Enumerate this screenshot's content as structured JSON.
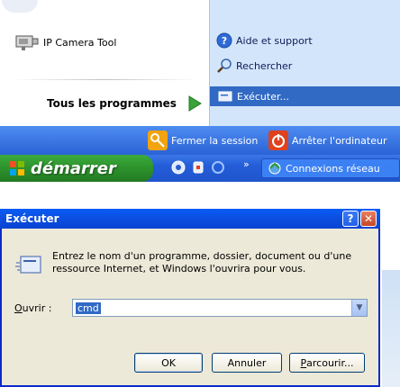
{
  "start_menu": {
    "programs": [
      {
        "label": "IP Camera Tool",
        "icon": "camera-icon"
      }
    ],
    "all_programs_label": "Tous les programmes",
    "right_items": [
      {
        "label": "Aide et support",
        "icon": "help-icon"
      },
      {
        "label": "Rechercher",
        "icon": "search-icon"
      },
      {
        "label": "Exécuter...",
        "icon": "run-icon"
      }
    ],
    "logoff_label": "Fermer la session",
    "shutdown_label": "Arrêter l'ordinateur"
  },
  "taskbar": {
    "start_label": "démarrer",
    "more_label": "»",
    "task_button_label": "Connexions réseau"
  },
  "dialog": {
    "title": "Exécuter",
    "description": "Entrez le nom d'un programme, dossier, document ou d'une ressource Internet, et Windows l'ouvrira pour vous.",
    "open_label_first": "O",
    "open_label_rest": "uvrir :",
    "open_value": "cmd",
    "ok_label": "OK",
    "cancel_label": "Annuler",
    "browse_label_first": "P",
    "browse_label_rest": "arcourir..."
  },
  "colors": {
    "highlight": "#316ac5",
    "taskbar_blue": "#245dd8",
    "start_green": "#2d922d",
    "title_blue": "#0b4ee0"
  }
}
